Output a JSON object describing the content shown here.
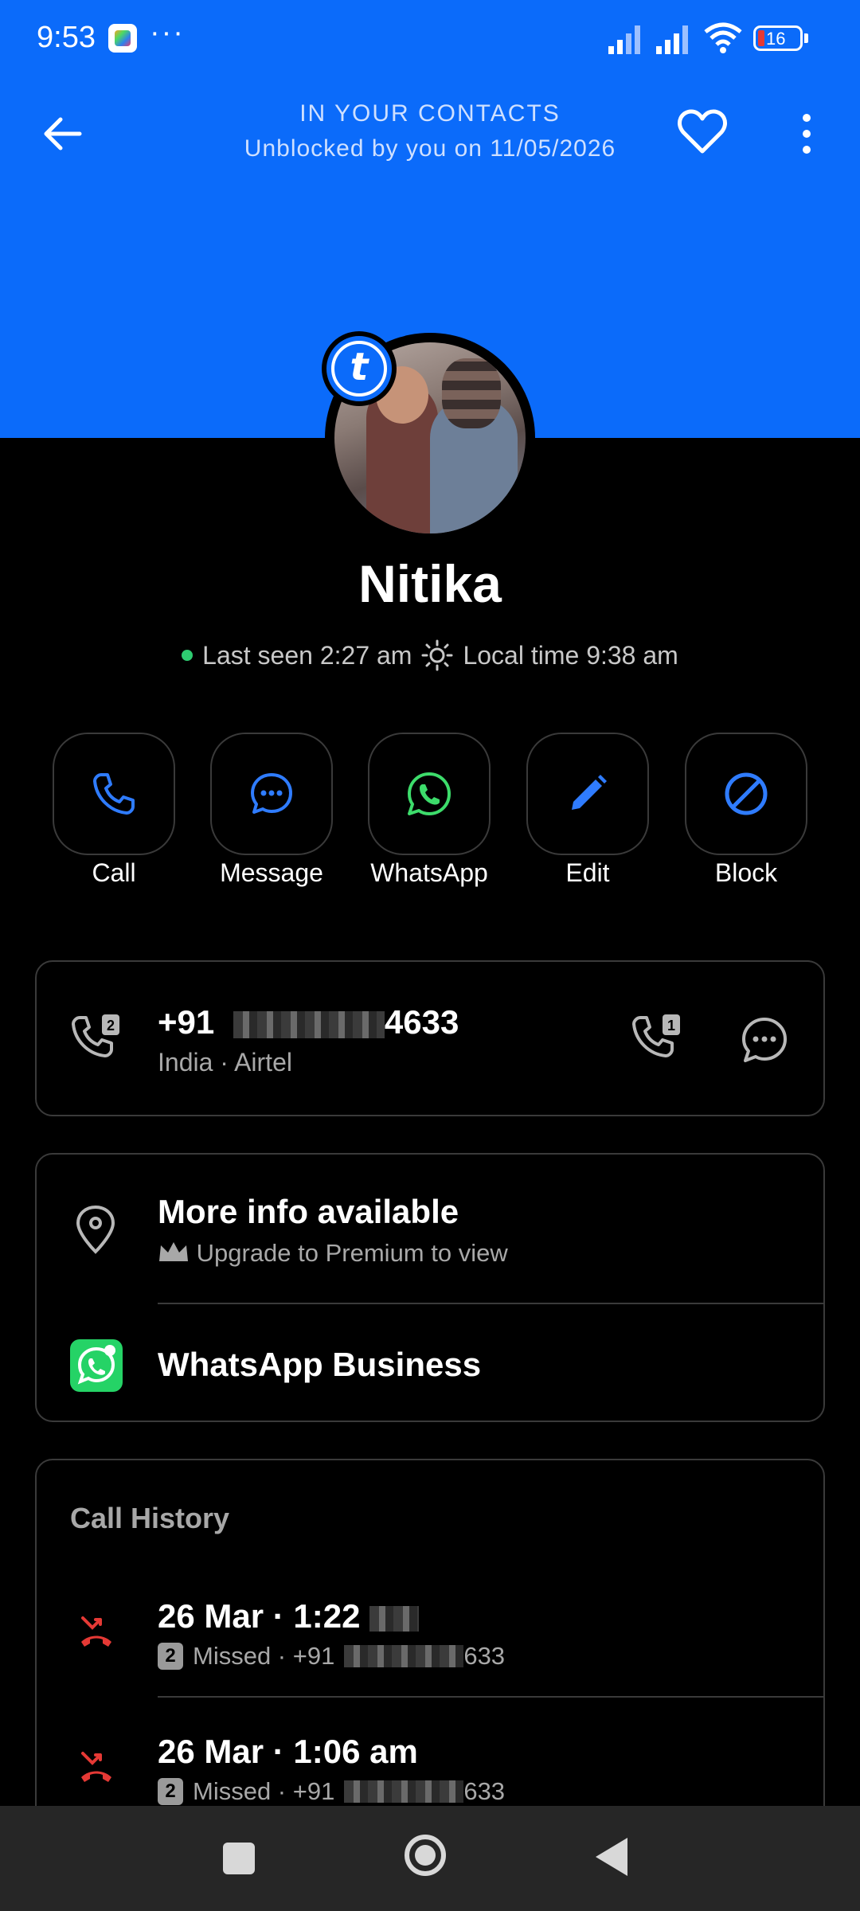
{
  "status_bar": {
    "time": "9:53",
    "more": "···",
    "battery": "16"
  },
  "header": {
    "contacts_label": "IN YOUR CONTACTS",
    "unblocked_label": "Unblocked by you on 11/05/2026",
    "accent": "#0b6bfa"
  },
  "profile": {
    "name": "Nitika",
    "badge_letter": "t",
    "last_seen": "Last seen 2:27 am",
    "local_time": "Local time 9:38 am"
  },
  "actions": [
    {
      "label": "Call",
      "icon": "phone-icon"
    },
    {
      "label": "Message",
      "icon": "message-icon"
    },
    {
      "label": "WhatsApp",
      "icon": "whatsapp-icon"
    },
    {
      "label": "Edit",
      "icon": "pencil-icon"
    },
    {
      "label": "Block",
      "icon": "block-icon"
    }
  ],
  "phone_card": {
    "prefix": "+91",
    "suffix": "4633",
    "carrier": "India · Airtel",
    "sim_left": "2",
    "sim_right": "1"
  },
  "info_card": {
    "title": "More info available",
    "subtitle": "Upgrade to Premium to view",
    "whatsapp_business": "WhatsApp Business"
  },
  "call_history": {
    "title": "Call History",
    "entries": [
      {
        "date": "26 Mar · 1:22",
        "sim": "2",
        "status": "Missed · +91",
        "suffix": "633"
      },
      {
        "date": "26 Mar · 1:06 am",
        "sim": "2",
        "status": "Missed · +91",
        "suffix": "633"
      }
    ]
  }
}
